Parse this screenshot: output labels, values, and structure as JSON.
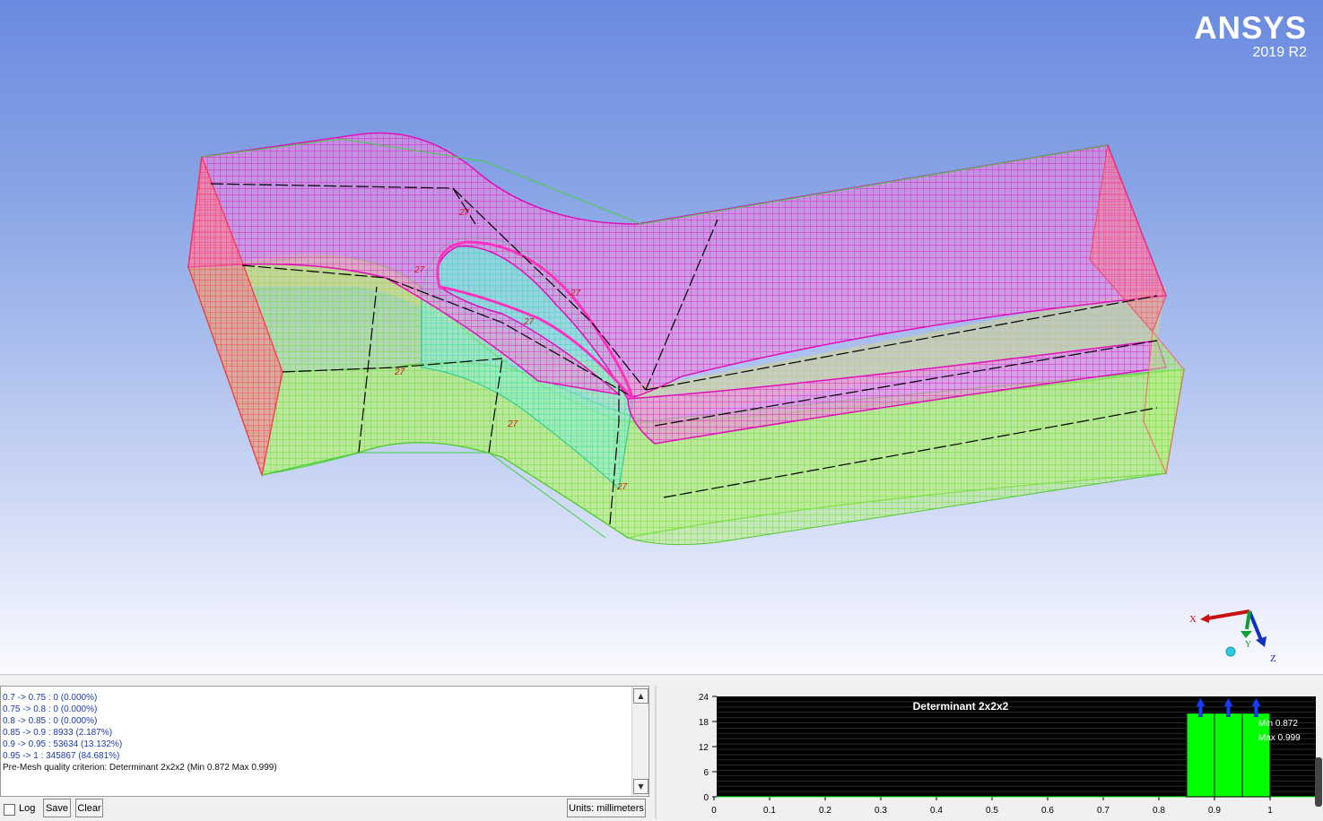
{
  "viewer": {
    "brand_name": "ANSYS",
    "brand_version": "2019 R2",
    "block_labels": [
      "27",
      "27",
      "27",
      "27",
      "27",
      "27",
      "27"
    ],
    "triad": {
      "x_label": "X",
      "y_label": "Y",
      "z_label": "Z"
    }
  },
  "messages": {
    "lines": [
      "0.7 -> 0.75 : 0 (0.000%)",
      "0.75 -> 0.8 : 0 (0.000%)",
      "0.8 -> 0.85 : 0 (0.000%)",
      "0.85 -> 0.9 : 8933 (2.187%)",
      "0.9 -> 0.95 : 53634 (13.132%)",
      "0.95 -> 1 : 345867 (84.681%)"
    ],
    "summary": "Pre-Mesh quality criterion: Determinant 2x2x2 (Min 0.872 Max 0.999)",
    "scroll_up_icon": "arrow-up-icon",
    "scroll_down_icon": "arrow-down-icon"
  },
  "controls": {
    "log_label": "Log",
    "log_checked": false,
    "save_label": "Save",
    "clear_label": "Clear",
    "units_label": "Units: millimeters"
  },
  "chart_data": {
    "type": "bar",
    "title": "Determinant 2x2x2",
    "x_ticks": [
      "0",
      "0.1",
      "0.2",
      "0.3",
      "0.4",
      "0.5",
      "0.6",
      "0.7",
      "0.8",
      "0.9",
      "1"
    ],
    "y_ticks": [
      "0",
      "6",
      "12",
      "18",
      "24"
    ],
    "xlim": [
      0,
      1
    ],
    "ylim": [
      0,
      24
    ],
    "bins": [
      {
        "from": 0.85,
        "to": 0.9,
        "value": 20
      },
      {
        "from": 0.9,
        "to": 0.95,
        "value": 20
      },
      {
        "from": 0.95,
        "to": 1.0,
        "value": 20
      }
    ],
    "bar_color": "#00ff00",
    "background": "#000000",
    "min_label": "Min 0.872",
    "max_label": "Max 0.999",
    "marker_icon": "up-arrow-marker-icon"
  },
  "colors": {
    "mesh_magenta": "#e030c8",
    "mesh_green": "#7cf040",
    "mesh_cyan": "#30e8c0",
    "edge_red": "#ff3050",
    "text_blue": "#1b3aa8"
  }
}
